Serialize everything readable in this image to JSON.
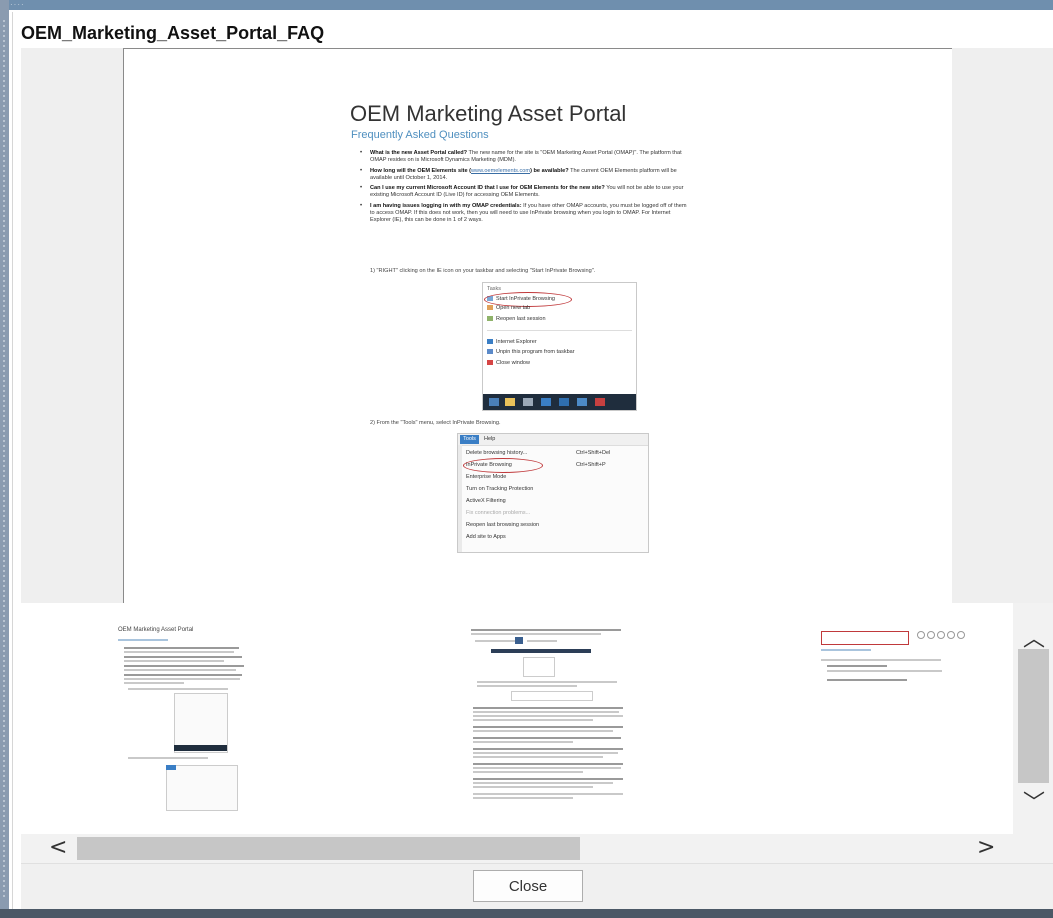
{
  "dialog": {
    "title": "OEM_Marketing_Asset_Portal_FAQ",
    "close_label": "Close"
  },
  "document": {
    "title": "OEM Marketing Asset Portal",
    "subtitle": "Frequently Asked Questions",
    "faq": [
      {
        "question": "What is the new Asset Portal called?",
        "answer": "The new name for the site is \"OEM Marketing Asset Portal (OMAP)\". The platform that OMAP resides on is Microsoft Dynamics Marketing (MDM)."
      },
      {
        "question_pre": "How long will the OEM Elements site (",
        "link": "www.oemelements.com",
        "question_post": ") be available?",
        "answer": "The current OEM Elements platform will be available until October 1, 2014."
      },
      {
        "question": "Can I use my current Microsoft Account ID that I use for OEM Elements for the new site?",
        "answer": "You will not be able to use your existing Microsoft Account ID (Live ID) for accessing OEM Elements."
      },
      {
        "question": "I am having issues logging in with my OMAP credentials:",
        "answer": "If you have other OMAP accounts, you must be logged off of them to access OMAP. If this does not work, then you will need to use InPrivate browsing when you login to OMAP. For Internet Explorer (IE), this can be done in 1 of 2 ways."
      }
    ],
    "steps": [
      "1)   \"RIGHT\" clicking on the IE icon on your taskbar and selecting \"Start InPrivate Browsing\".",
      "2)   From the \"Tools\" menu, select InPrivate Browsing."
    ],
    "jump_list": {
      "header": "Tasks",
      "items": [
        "Start InPrivate Browsing",
        "Open new tab",
        "Reopen last session"
      ],
      "items2": [
        "Internet Explorer",
        "Unpin this program from taskbar",
        "Close window"
      ]
    },
    "tools_menu": {
      "tab_active": "Tools",
      "tab_other": "Help",
      "items": [
        {
          "label": "Delete browsing history...",
          "shortcut": "Ctrl+Shift+Del"
        },
        {
          "label": "InPrivate Browsing",
          "shortcut": "Ctrl+Shift+P"
        },
        {
          "label": "Enterprise Mode",
          "shortcut": ""
        },
        {
          "label": "Turn on Tracking Protection",
          "shortcut": ""
        },
        {
          "label": "ActiveX Filtering",
          "shortcut": ""
        },
        {
          "label": "Fix connection problems...",
          "shortcut": ""
        },
        {
          "label": "Reopen last browsing session",
          "shortcut": ""
        },
        {
          "label": "Add site to Apps",
          "shortcut": ""
        }
      ]
    }
  },
  "thumbnails": {
    "page1_title": "OEM Marketing Asset Portal"
  },
  "icons": {
    "scroll_up": "chevron-up-icon",
    "scroll_down": "chevron-down-icon",
    "scroll_left": "chevron-left-icon",
    "scroll_right": "chevron-right-icon"
  },
  "glyphs": {
    "up": "︿",
    "down": "﹀",
    "left": "<",
    "right": ">"
  }
}
